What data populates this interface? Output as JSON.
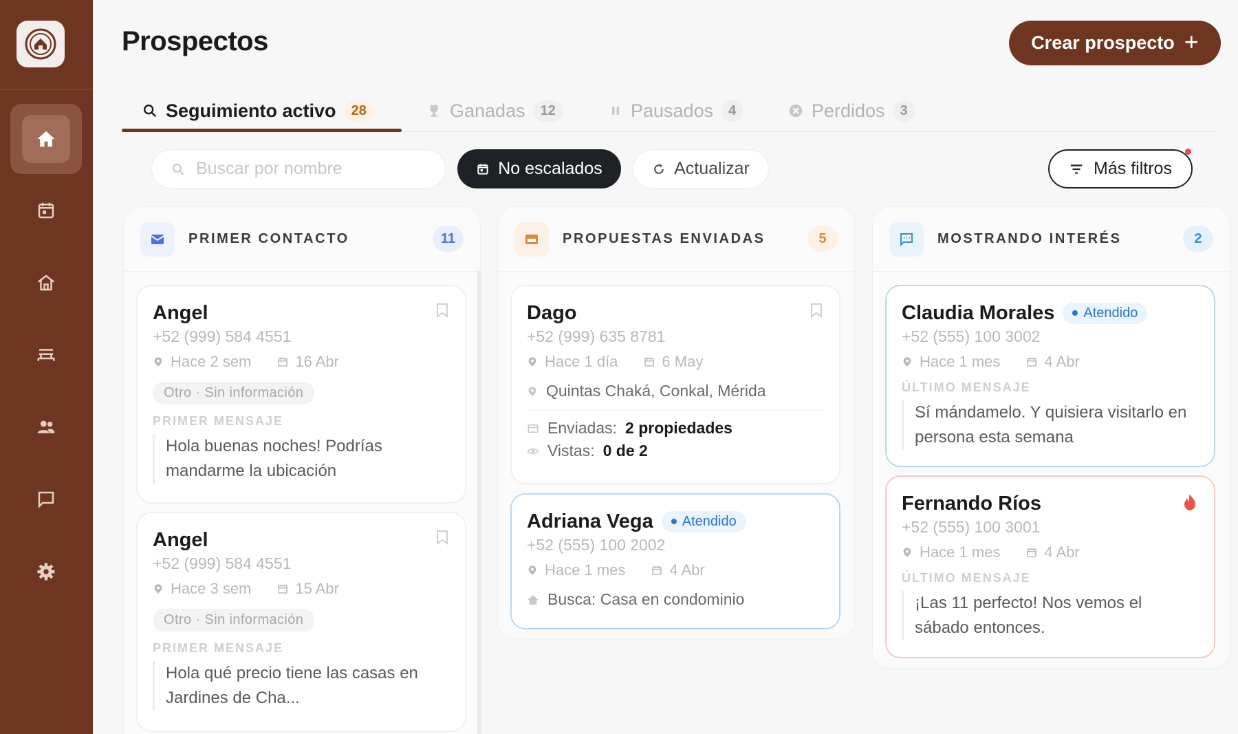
{
  "header": {
    "title": "Prospectos",
    "create_label": "Crear prospecto"
  },
  "sidebar": {
    "items": [
      {
        "icon": "home-icon",
        "active": true
      },
      {
        "icon": "calendar-icon"
      },
      {
        "icon": "house-icon"
      },
      {
        "icon": "bed-icon"
      },
      {
        "icon": "people-icon"
      },
      {
        "icon": "chat-icon"
      },
      {
        "icon": "gear-icon"
      }
    ]
  },
  "tabs": [
    {
      "label": "Seguimiento activo",
      "count": "28",
      "icon": "search-icon"
    },
    {
      "label": "Ganadas",
      "count": "12",
      "icon": "trophy-icon"
    },
    {
      "label": "Pausados",
      "count": "4",
      "icon": "pause-icon"
    },
    {
      "label": "Perdidos",
      "count": "3",
      "icon": "x-circle-icon"
    }
  ],
  "toolbar": {
    "search_placeholder": "Buscar por nombre",
    "no_escalados": "No escalados",
    "actualizar": "Actualizar",
    "mas_filtros": "Más filtros"
  },
  "columns": [
    {
      "title": "PRIMER CONTACTO",
      "count": "11",
      "cards": [
        {
          "name": "Angel",
          "phone": "+52 (999) 584 4551",
          "ago": "Hace 2 sem",
          "date": "16 Abr",
          "tag": "Otro · Sin información",
          "msg_label": "PRIMER MENSAJE",
          "msg": "Hola buenas noches! Podrías mandarme la ubicación"
        },
        {
          "name": "Angel",
          "phone": "+52 (999) 584 4551",
          "ago": "Hace 3 sem",
          "date": "15 Abr",
          "tag": "Otro · Sin información",
          "msg_label": "PRIMER MENSAJE",
          "msg": "Hola qué precio tiene las casas en Jardines de Cha..."
        }
      ]
    },
    {
      "title": "PROPUESTAS ENVIADAS",
      "count": "5",
      "cards": [
        {
          "name": "Dago",
          "phone": "+52 (999) 635 8781",
          "ago": "Hace 1 día",
          "date": "6 May",
          "location": "Quintas Chaká, Conkal, Mérida",
          "sent_label": "Enviadas:",
          "sent_value": "2 propiedades",
          "views_label": "Vistas:",
          "views_value": "0 de 2"
        },
        {
          "name": "Adriana Vega",
          "badge": "Atendido",
          "phone": "+52 (555) 100 2002",
          "ago": "Hace 1 mes",
          "date": "4 Abr",
          "search": "Busca: Casa en condominio"
        }
      ]
    },
    {
      "title": "MOSTRANDO INTERÉS",
      "count": "2",
      "cards": [
        {
          "name": "Claudia Morales",
          "badge": "Atendido",
          "phone": "+52 (555) 100 3002",
          "ago": "Hace 1 mes",
          "date": "4 Abr",
          "msg_label": "ÚLTIMO MENSAJE",
          "msg": "Sí mándamelo. Y quisiera visitarlo en persona esta semana"
        },
        {
          "name": "Fernando Ríos",
          "phone": "+52 (555) 100 3001",
          "ago": "Hace 1 mes",
          "date": "4 Abr",
          "msg_label": "ÚLTIMO MENSAJE",
          "msg": "¡Las 11 perfecto! Nos vemos el sábado entonces."
        }
      ]
    }
  ],
  "colors": {
    "brand": "#6e3621",
    "dark": "#1e2125",
    "accent_blue": "#2b74c8",
    "accent_orange": "#d88a3a"
  }
}
